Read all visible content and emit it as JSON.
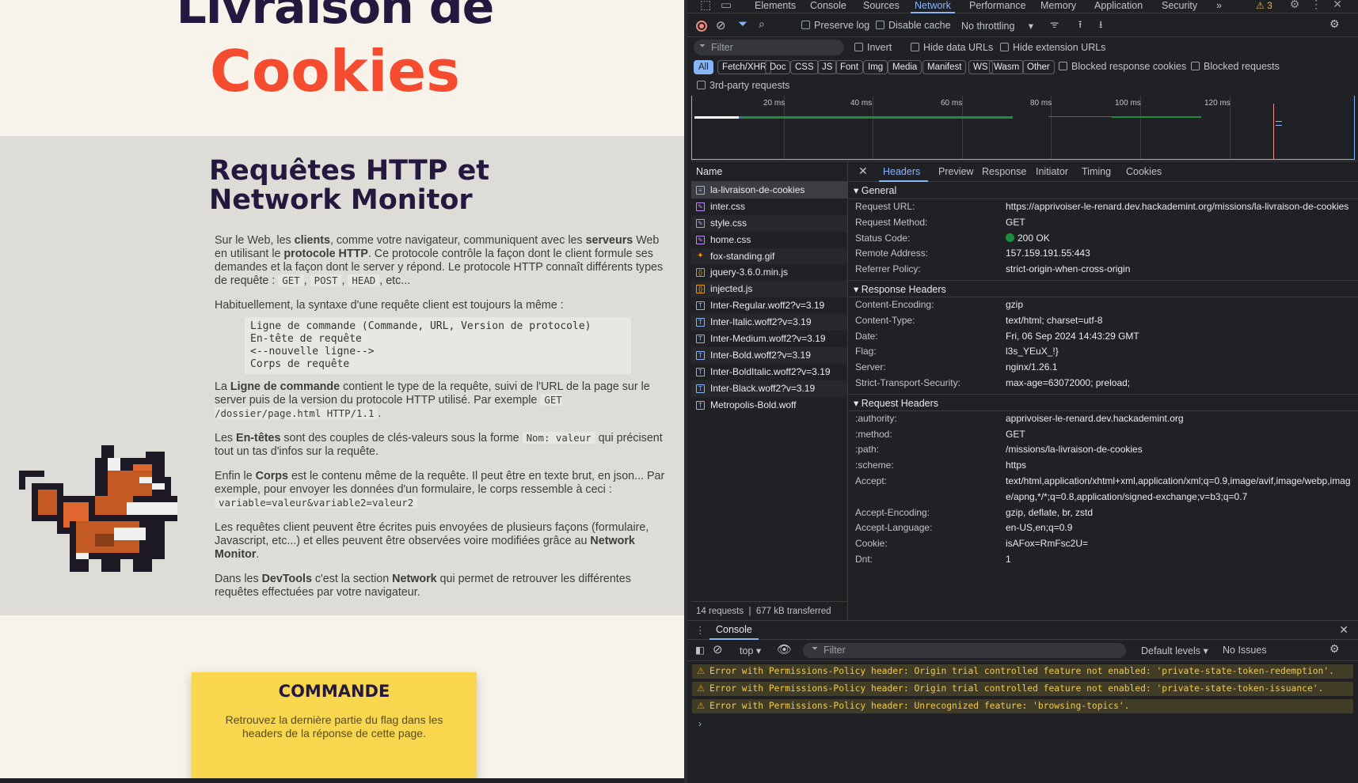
{
  "page": {
    "hero_line1": "Livraison de",
    "hero_line2": "Cookies",
    "lesson_title": "Requêtes HTTP et Network Monitor",
    "p1_a": "Sur le Web, les ",
    "p1_b": "clients",
    "p1_c": ", comme votre navigateur, communiquent avec les ",
    "p1_d": "serveurs",
    "p1_e": " Web en utilisant le ",
    "p1_f": "protocole HTTP",
    "p1_g": ". Ce protocole contrôle la façon dont le client formule ses demandes et la façon dont le server y répond. Le protocole HTTP connaît différents types de requête : ",
    "p1_code1": "GET",
    "p1_code2": "POST",
    "p1_code3": "HEAD",
    "p1_end": ", etc...",
    "p2": "Habituellement, la syntaxe d'une requête client est toujours la même :",
    "codeblock": "Ligne de commande (Commande, URL, Version de protocole)\nEn-tête de requête\n<--nouvelle ligne-->\nCorps de requête",
    "p3_a": "La ",
    "p3_b": "Ligne de commande",
    "p3_c": " contient le type de la requête, suivi de l'URL de la page sur le server puis de la version du protocole HTTP utilisé. Par exemple ",
    "p3_code": "GET /dossier/page.html HTTP/1.1",
    "p3_end": ".",
    "p4_a": "Les ",
    "p4_b": "En-têtes",
    "p4_c": " sont des couples de clés-valeurs sous la forme ",
    "p4_code": "Nom: valeur",
    "p4_d": " qui précisent tout un tas d'infos sur la requête.",
    "p5_a": "Enfin le ",
    "p5_b": "Corps",
    "p5_c": " est le contenu même de la requête. Il peut être en texte brut, en json... Par exemple, pour envoyer les données d'un formulaire, le corps ressemble à ceci : ",
    "p5_code": "variable=valeur&variable2=valeur2",
    "p6_a": "Les requêtes client peuvent être écrites puis envoyées de plusieurs façons (formulaire, Javascript, etc...) et elles peuvent être observées voire modifiées grâce au ",
    "p6_b": "Network Monitor",
    "p6_c": ".",
    "p7_a": "Dans les ",
    "p7_b": "DevTools",
    "p7_c": " c'est la section ",
    "p7_d": "Network",
    "p7_e": " qui permet de retrouver les différentes requêtes effectuées par votre navigateur.",
    "commande_title": "COMMANDE",
    "commande_text": "Retrouvez la dernière partie du flag dans les headers de la réponse de cette page."
  },
  "devtools": {
    "tabs": [
      "Elements",
      "Console",
      "Sources",
      "Network",
      "Performance",
      "Memory",
      "Application",
      "Security"
    ],
    "more": "»",
    "warnings": "3",
    "toolbar": {
      "preserve_log": "Preserve log",
      "disable_cache": "Disable cache",
      "throttling": "No throttling"
    },
    "filter": {
      "placeholder": "Filter",
      "invert": "Invert",
      "hide_data_urls": "Hide data URLs",
      "hide_ext_urls": "Hide extension URLs"
    },
    "types": [
      "All",
      "Fetch/XHR",
      "Doc",
      "CSS",
      "JS",
      "Font",
      "Img",
      "Media",
      "Manifest",
      "WS",
      "Wasm",
      "Other"
    ],
    "blocked_cookies": "Blocked response cookies",
    "blocked_requests": "Blocked requests",
    "third_party": "3rd-party requests",
    "timeline_labels": [
      "20 ms",
      "40 ms",
      "60 ms",
      "80 ms",
      "100 ms",
      "120 ms"
    ],
    "name_header": "Name",
    "requests": [
      {
        "name": "la-livraison-de-cookies",
        "type": "doc"
      },
      {
        "name": "inter.css",
        "type": "css"
      },
      {
        "name": "style.css",
        "type": "css"
      },
      {
        "name": "home.css",
        "type": "css"
      },
      {
        "name": "fox-standing.gif",
        "type": "img"
      },
      {
        "name": "jquery-3.6.0.min.js",
        "type": "js"
      },
      {
        "name": "injected.js",
        "type": "js"
      },
      {
        "name": "Inter-Regular.woff2?v=3.19",
        "type": "font"
      },
      {
        "name": "Inter-Italic.woff2?v=3.19",
        "type": "font"
      },
      {
        "name": "Inter-Medium.woff2?v=3.19",
        "type": "font"
      },
      {
        "name": "Inter-Bold.woff2?v=3.19",
        "type": "font"
      },
      {
        "name": "Inter-BoldItalic.woff2?v=3.19",
        "type": "font"
      },
      {
        "name": "Inter-Black.woff2?v=3.19",
        "type": "font"
      },
      {
        "name": "Metropolis-Bold.woff",
        "type": "font"
      }
    ],
    "requests_count": "14 requests",
    "transferred": "677 kB transferred",
    "detail_tabs": [
      "Headers",
      "Preview",
      "Response",
      "Initiator",
      "Timing",
      "Cookies"
    ],
    "general_title": "General",
    "general": [
      {
        "k": "Request URL:",
        "v": "https://apprivoiser-le-renard.dev.hackademint.org/missions/la-livraison-de-cookies"
      },
      {
        "k": "Request Method:",
        "v": "GET"
      },
      {
        "k": "Status Code:",
        "v": "200 OK"
      },
      {
        "k": "Remote Address:",
        "v": "157.159.191.55:443"
      },
      {
        "k": "Referrer Policy:",
        "v": "strict-origin-when-cross-origin"
      }
    ],
    "response_title": "Response Headers",
    "response": [
      {
        "k": "Content-Encoding:",
        "v": "gzip"
      },
      {
        "k": "Content-Type:",
        "v": "text/html; charset=utf-8"
      },
      {
        "k": "Date:",
        "v": "Fri, 06 Sep 2024 14:43:29 GMT"
      },
      {
        "k": "Flag:",
        "v": "l3s_YEuX_!}"
      },
      {
        "k": "Server:",
        "v": "nginx/1.26.1"
      },
      {
        "k": "Strict-Transport-Security:",
        "v": "max-age=63072000; preload;"
      }
    ],
    "request_title": "Request Headers",
    "request": [
      {
        "k": ":authority:",
        "v": "apprivoiser-le-renard.dev.hackademint.org"
      },
      {
        "k": ":method:",
        "v": "GET"
      },
      {
        "k": ":path:",
        "v": "/missions/la-livraison-de-cookies"
      },
      {
        "k": ":scheme:",
        "v": "https"
      },
      {
        "k": "Accept:",
        "v": "text/html,application/xhtml+xml,application/xml;q=0.9,image/avif,image/webp,image/apng,*/*;q=0.8,application/signed-exchange;v=b3;q=0.7"
      },
      {
        "k": "Accept-Encoding:",
        "v": "gzip, deflate, br, zstd"
      },
      {
        "k": "Accept-Language:",
        "v": "en-US,en;q=0.9"
      },
      {
        "k": "Cookie:",
        "v": "isAFox=RmFsc2U="
      },
      {
        "k": "Dnt:",
        "v": "1"
      }
    ],
    "console": {
      "tab": "Console",
      "context": "top",
      "filter": "Filter",
      "levels": "Default levels",
      "issues": "No Issues",
      "messages": [
        "Error with Permissions-Policy header: Origin trial controlled feature not enabled: 'private-state-token-redemption'.",
        "Error with Permissions-Policy header: Origin trial controlled feature not enabled: 'private-state-token-issuance'.",
        "Error with Permissions-Policy header: Unrecognized feature: 'browsing-topics'."
      ]
    }
  }
}
